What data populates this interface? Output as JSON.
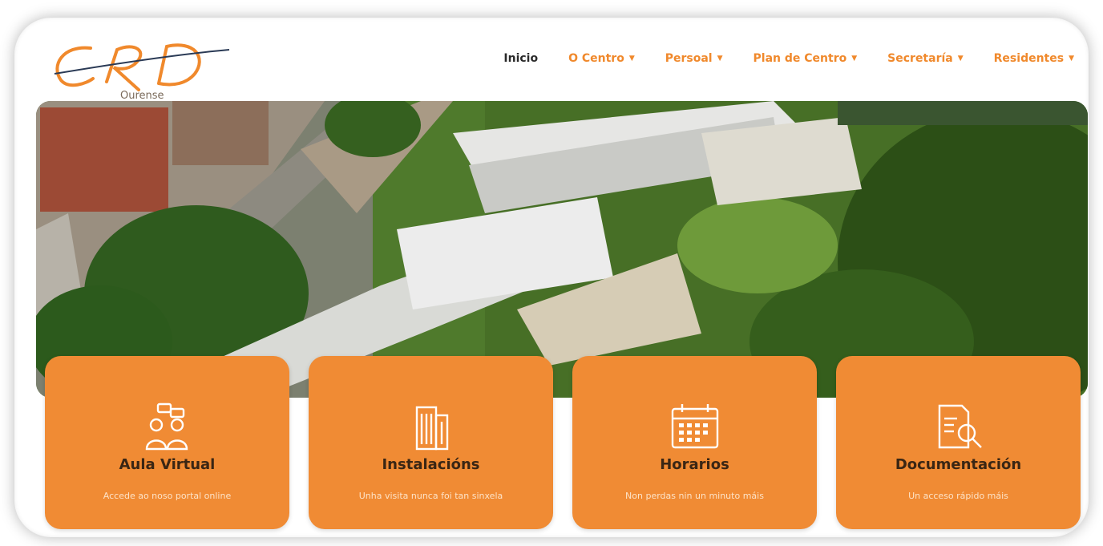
{
  "brand": {
    "subtitle": "Ourense"
  },
  "nav": {
    "items": [
      {
        "label": "Inicio",
        "active": true,
        "dropdown": false
      },
      {
        "label": "O Centro",
        "active": false,
        "dropdown": true
      },
      {
        "label": "Persoal",
        "active": false,
        "dropdown": true
      },
      {
        "label": "Plan de Centro",
        "active": false,
        "dropdown": true
      },
      {
        "label": "Secretaría",
        "active": false,
        "dropdown": true
      },
      {
        "label": "Residentes",
        "active": false,
        "dropdown": true
      }
    ]
  },
  "cards": [
    {
      "title": "Aula Virtual",
      "subtitle": "Accede ao noso portal online",
      "icon": "users-chat-icon"
    },
    {
      "title": "Instalacións",
      "subtitle": "Unha visita nunca foi tan sinxela",
      "icon": "building-icon"
    },
    {
      "title": "Horarios",
      "subtitle": "Non perdas nin un minuto máis",
      "icon": "calendar-icon"
    },
    {
      "title": "Documentación",
      "subtitle": "Un acceso rápido máis",
      "icon": "document-search-icon"
    }
  ],
  "colors": {
    "accent": "#f08b34",
    "nav_text": "#f0892c",
    "active_text": "#2a2a2a"
  }
}
